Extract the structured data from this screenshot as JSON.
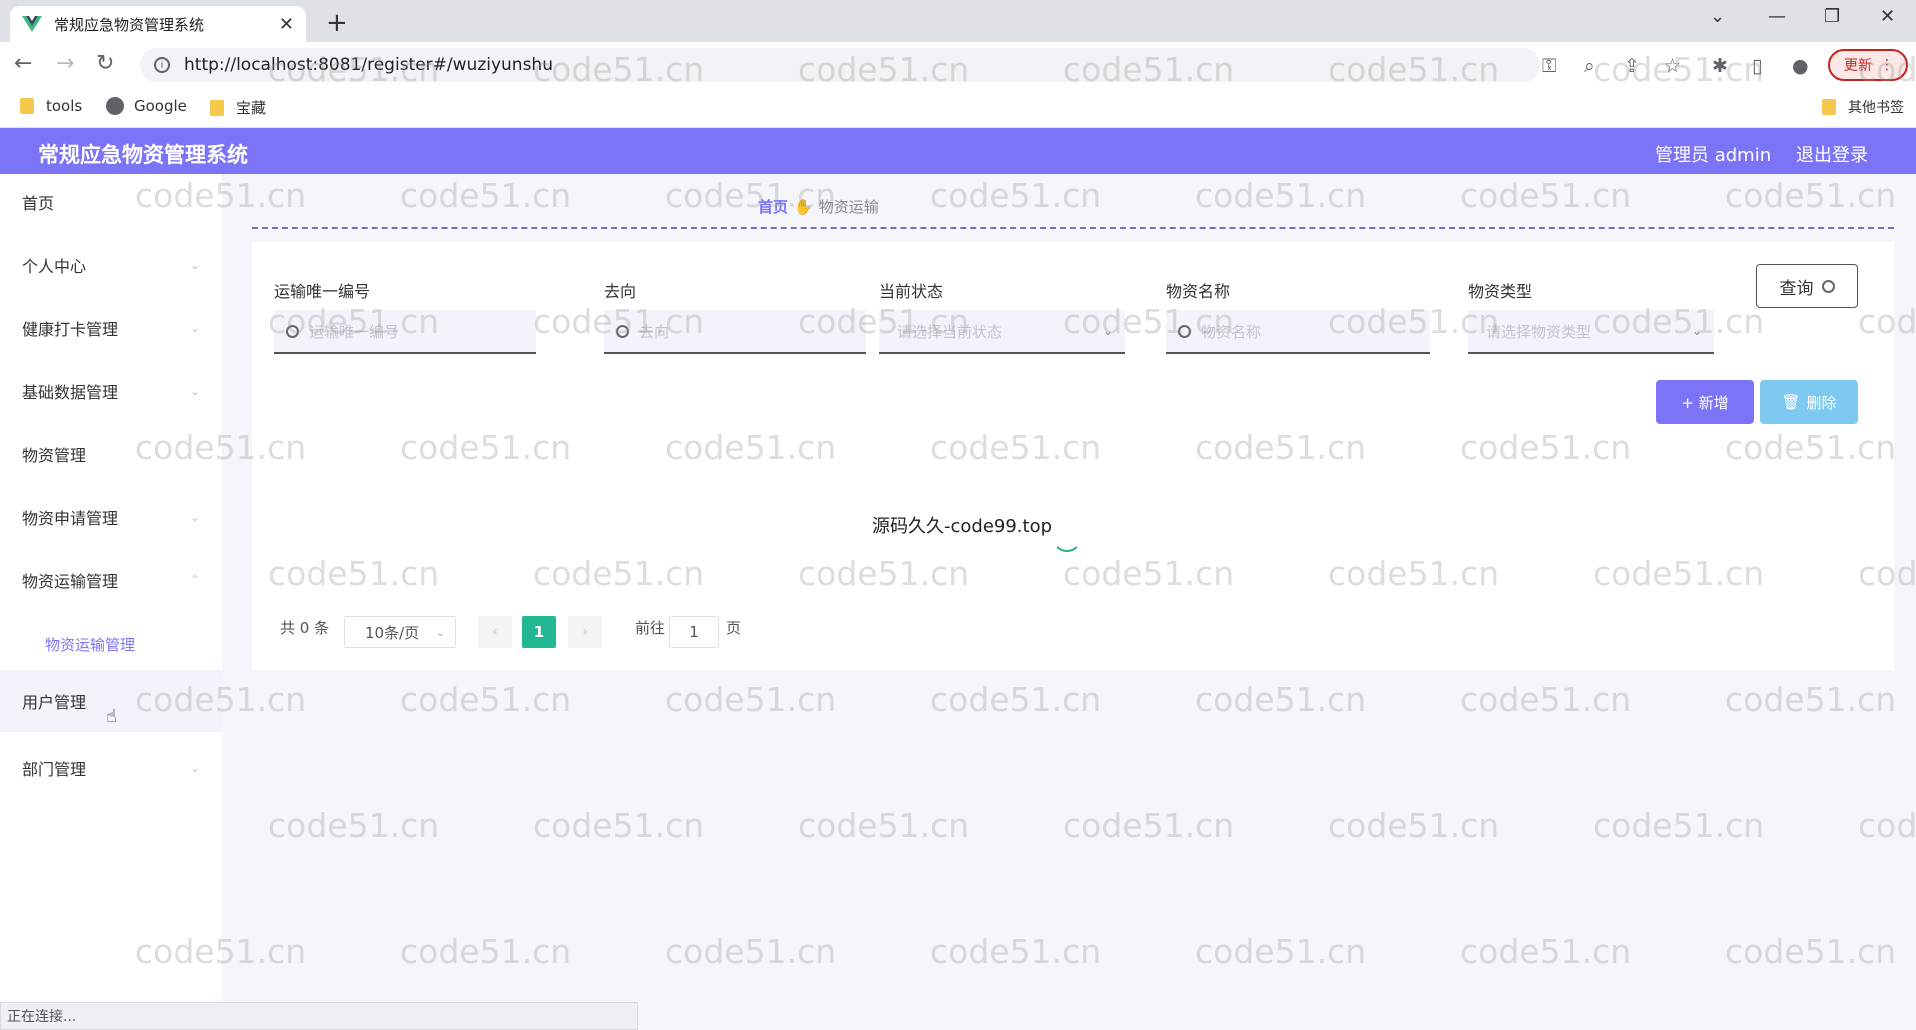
{
  "browser": {
    "tab_title": "常规应急物资管理系统",
    "tab_close": "✕",
    "new_tab": "+",
    "url": "http://localhost:8081/register#/wuziyunshu",
    "update_label": "更新",
    "bookmarks": [
      {
        "label": "tools",
        "icon": "folder-icon"
      },
      {
        "label": "Google",
        "icon": "globe-icon"
      },
      {
        "label": "宝藏",
        "icon": "folder-icon"
      }
    ],
    "other_bookmarks": "其他书签",
    "status_text": "正在连接..."
  },
  "header": {
    "title": "常规应急物资管理系统",
    "user": "管理员 admin",
    "logout": "退出登录"
  },
  "sidebar": {
    "items": [
      {
        "label": "首页",
        "chevron": false
      },
      {
        "label": "个人中心",
        "chevron": true
      },
      {
        "label": "健康打卡管理",
        "chevron": true
      },
      {
        "label": "基础数据管理",
        "chevron": true
      },
      {
        "label": "物资管理",
        "chevron": false
      },
      {
        "label": "物资申请管理",
        "chevron": true
      },
      {
        "label": "物资运输管理",
        "chevron": true
      },
      {
        "label": "用户管理",
        "chevron": false
      },
      {
        "label": "部门管理",
        "chevron": true
      }
    ],
    "submenu_label": "物资运输管理"
  },
  "breadcrumb": {
    "home": "首页",
    "current": "物资运输"
  },
  "search": {
    "fields": [
      {
        "label": "运输唯一编号",
        "placeholder": "运输唯一编号",
        "type": "input"
      },
      {
        "label": "去向",
        "placeholder": "去向",
        "type": "input"
      },
      {
        "label": "当前状态",
        "placeholder": "请选择当前状态",
        "type": "select"
      },
      {
        "label": "物资名称",
        "placeholder": "物资名称",
        "type": "input"
      },
      {
        "label": "物资类型",
        "placeholder": "请选择物资类型",
        "type": "select"
      }
    ],
    "query_label": "查询"
  },
  "actions": {
    "add_label": "+ 新增",
    "delete_label": "删除"
  },
  "loading_text": "源码久久-code99.top",
  "pagination": {
    "total": "共 0 条",
    "page_size": "10条/页",
    "current_page": "1",
    "goto_label": "前往",
    "goto_value": "1",
    "page_unit": "页"
  },
  "watermark_text": "code51.cn",
  "colors": {
    "accent": "#7c74f7",
    "info": "#7dc9f0",
    "pager_active": "#23b893"
  }
}
